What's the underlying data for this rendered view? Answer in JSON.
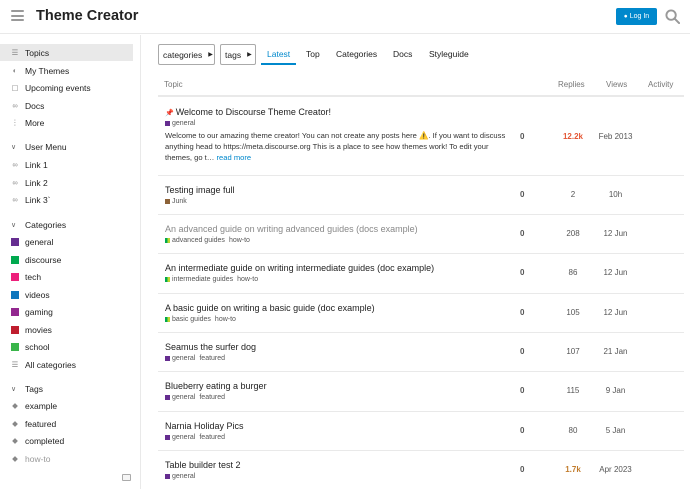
{
  "header": {
    "title": "Theme Creator",
    "login_label": "Log In"
  },
  "sidebar": {
    "nav": [
      {
        "label": "Topics",
        "icon": "topics-icon"
      },
      {
        "label": "My Themes",
        "icon": "palette-icon"
      },
      {
        "label": "Upcoming events",
        "icon": "calendar-icon"
      },
      {
        "label": "Docs",
        "icon": "link-icon"
      },
      {
        "label": "More",
        "icon": "more-icon"
      }
    ],
    "user_menu_label": "User Menu",
    "user_links": [
      "Link 1",
      "Link 2",
      "Link 3`"
    ],
    "categories_label": "Categories",
    "categories": [
      {
        "label": "general",
        "color": "#652d90"
      },
      {
        "label": "discourse",
        "color": "#00a94f"
      },
      {
        "label": "tech",
        "color": "#ed207b"
      },
      {
        "label": "videos",
        "color": "#0e76bd"
      },
      {
        "label": "gaming",
        "color": "#92278f"
      },
      {
        "label": "movies",
        "color": "#bf1e2e"
      },
      {
        "label": "school",
        "color": "#3ab54a"
      }
    ],
    "all_categories_label": "All categories",
    "tags_label": "Tags",
    "tags": [
      "example",
      "featured",
      "completed",
      "how-to"
    ]
  },
  "nav": {
    "categories_dropdown": "categories",
    "tags_dropdown": "tags",
    "tabs": [
      "Latest",
      "Top",
      "Categories",
      "Docs",
      "Styleguide"
    ]
  },
  "table": {
    "headers": {
      "topic": "Topic",
      "replies": "Replies",
      "views": "Views",
      "activity": "Activity"
    },
    "rows": [
      {
        "title": "Welcome to Discourse Theme Creator!",
        "category": "general",
        "tags": [],
        "posters": "0",
        "replies": "12.2k",
        "activity": "Feb 2013",
        "excerpt": "Welcome to our amazing theme creator! You can not create any posts here ⚠️. If you want to discuss anything head to https://meta.discourse.org This is a place to see how themes work! To edit your themes, go t…",
        "read_more": "read more"
      },
      {
        "title": "Testing image full",
        "category": "Junk",
        "tags": [],
        "posters": "0",
        "replies": "2",
        "activity": "10h"
      },
      {
        "title": "An advanced guide on writing advanced guides (docs example)",
        "category": "advanced guides",
        "tags": [
          "how-to"
        ],
        "posters": "0",
        "replies": "208",
        "activity": "12 Jun"
      },
      {
        "title": "An intermediate guide on writing intermediate guides (doc example)",
        "category": "intermediate guides",
        "tags": [
          "how-to"
        ],
        "posters": "0",
        "replies": "86",
        "activity": "12 Jun"
      },
      {
        "title": "A basic guide on writing a basic guide (doc example)",
        "category": "basic guides",
        "tags": [
          "how-to"
        ],
        "posters": "0",
        "replies": "105",
        "activity": "12 Jun"
      },
      {
        "title": "Seamus the surfer dog",
        "category": "general",
        "tags": [
          "featured"
        ],
        "posters": "0",
        "replies": "107",
        "activity": "21 Jan"
      },
      {
        "title": "Blueberry eating a burger",
        "category": "general",
        "tags": [
          "featured"
        ],
        "posters": "0",
        "replies": "115",
        "activity": "9 Jan"
      },
      {
        "title": "Narnia Holiday Pics",
        "category": "general",
        "tags": [
          "featured"
        ],
        "posters": "0",
        "replies": "80",
        "activity": "5 Jan"
      },
      {
        "title": "Table builder test 2",
        "category": "general",
        "tags": [],
        "posters": "0",
        "replies": "1.7k",
        "activity": "Apr 2023"
      }
    ]
  },
  "colors": {
    "accent": "#0088cc",
    "hot": "#e45735",
    "warm": "#c27c2c",
    "junk": "#8c6238"
  }
}
